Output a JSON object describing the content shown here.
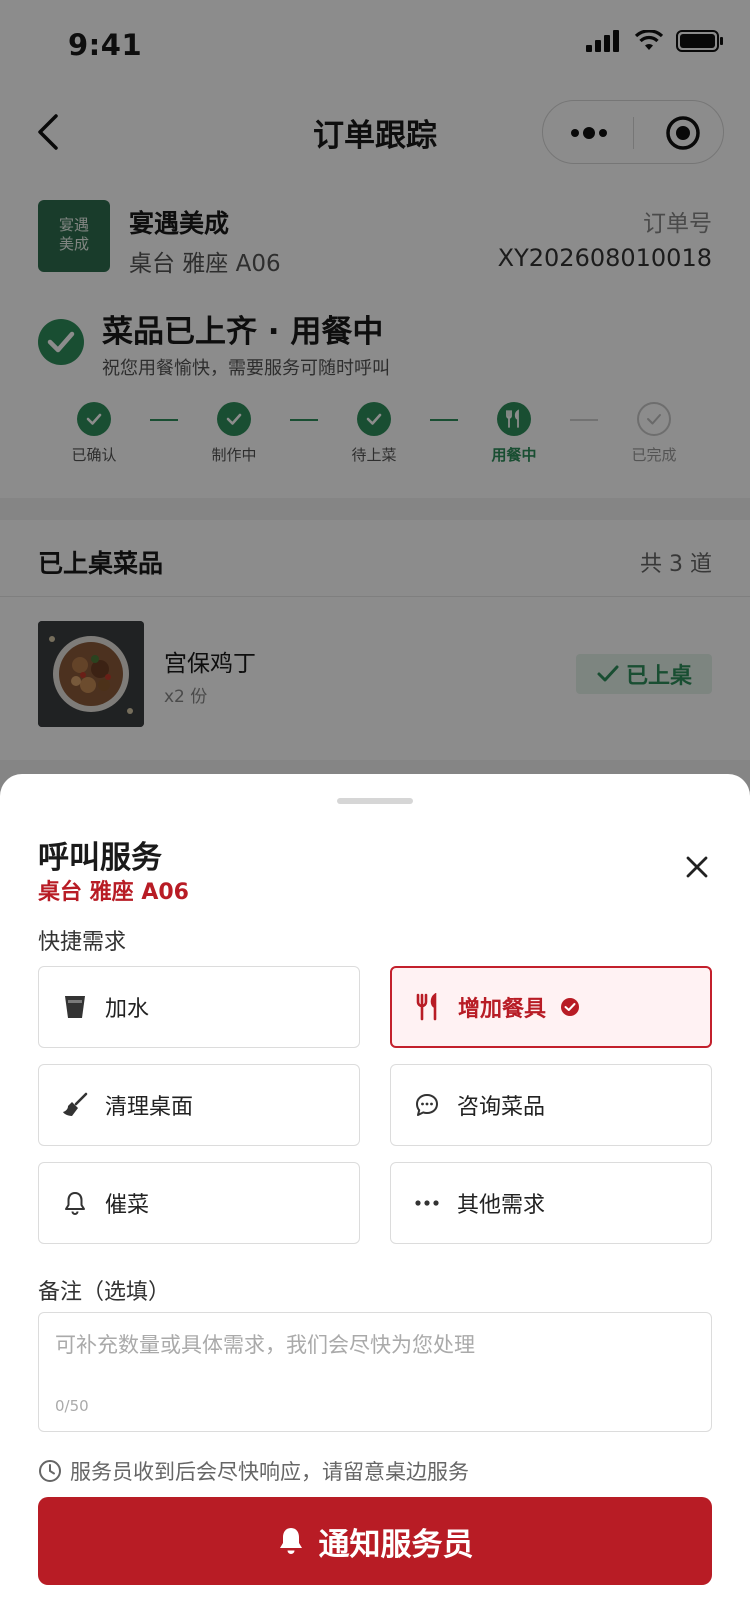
{
  "status_bar": {
    "time": "9:41"
  },
  "nav": {
    "title": "订单跟踪"
  },
  "store": {
    "logo_text_line1": "宴遇",
    "logo_text_line2": "美成",
    "name": "宴遇美成",
    "table": "桌台 雅座 A06",
    "order_label": "订单号",
    "order_no": "XY202608010018"
  },
  "order_status": {
    "title": "菜品已上齐 · 用餐中",
    "subtitle": "祝您用餐愉快，需要服务可随时呼叫"
  },
  "steps": [
    {
      "label": "已确认",
      "state": "done"
    },
    {
      "label": "制作中",
      "state": "done"
    },
    {
      "label": "待上菜",
      "state": "done"
    },
    {
      "label": "用餐中",
      "state": "active"
    },
    {
      "label": "已完成",
      "state": "pending"
    }
  ],
  "served": {
    "title": "已上桌菜品",
    "count": "共 3 道",
    "dish": {
      "name": "宫保鸡丁",
      "qty": "x2 份",
      "badge": "已上桌"
    }
  },
  "sheet": {
    "title": "呼叫服务",
    "table": "桌台 雅座 A06",
    "quick_label": "快捷需求",
    "options": [
      {
        "label": "加水",
        "icon": "cup-icon",
        "selected": false
      },
      {
        "label": "增加餐具",
        "icon": "utensils-icon",
        "selected": true
      },
      {
        "label": "清理桌面",
        "icon": "broom-icon",
        "selected": false
      },
      {
        "label": "咨询菜品",
        "icon": "chat-icon",
        "selected": false
      },
      {
        "label": "催菜",
        "icon": "bell-icon",
        "selected": false
      },
      {
        "label": "其他需求",
        "icon": "more-icon",
        "selected": false
      }
    ],
    "remark_label": "备注（选填）",
    "remark_placeholder": "可补充数量或具体需求，我们会尽快为您处理",
    "remark_count": "0/50",
    "hint": "服务员收到后会尽快响应，请留意桌边服务",
    "button": "通知服务员"
  },
  "colors": {
    "accent_red": "#b81c25",
    "success_green": "#2f8f5b"
  }
}
